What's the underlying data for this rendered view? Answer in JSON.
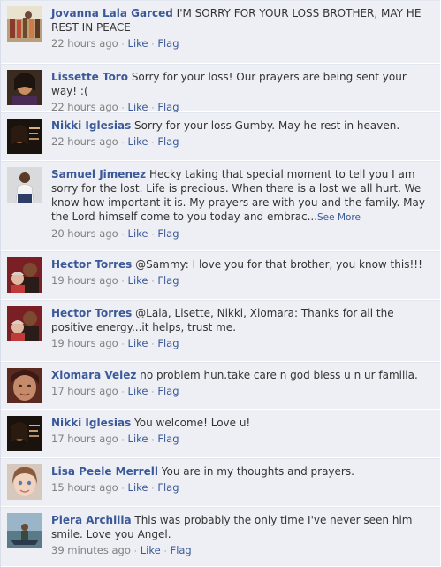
{
  "comments": [
    {
      "author": "Jovanna Lala Garced",
      "text": "I'M SORRY FOR YOUR LOSS BROTHER, MAY HE REST IN PEACE",
      "time": "22 hours ago",
      "like": "Like",
      "flag": "Flag",
      "avatar": "avatar-jovanna",
      "see_more": ""
    },
    {
      "author": "Lissette Toro",
      "text": "Sorry for your loss! Our prayers are being sent your way! :(",
      "time": "22 hours ago",
      "like": "Like",
      "flag": "Flag",
      "avatar": "avatar-lissette",
      "see_more": ""
    },
    {
      "author": "Nikki Iglesias",
      "text": "Sorry for your loss Gumby. May he rest in heaven.",
      "time": "22 hours ago",
      "like": "Like",
      "flag": "Flag",
      "avatar": "avatar-nikki",
      "see_more": ""
    },
    {
      "author": "Samuel Jimenez",
      "text": "Hecky taking that special moment to tell you I am sorry for the lost. Life is precious. When there is a lost we all hurt. We know how important it is. My prayers are with you and the family. May the Lord himself come to you today and embrac...",
      "time": "20 hours ago",
      "like": "Like",
      "flag": "Flag",
      "avatar": "avatar-samuel",
      "see_more": "See More"
    },
    {
      "author": "Hector Torres",
      "text": "@Sammy: I love you for that brother, you know this!!!",
      "time": "19 hours ago",
      "like": "Like",
      "flag": "Flag",
      "avatar": "avatar-hector",
      "see_more": ""
    },
    {
      "author": "Hector Torres",
      "text": "@Lala, Lisette, Nikki, Xiomara: Thanks for all the positive energy...it helps, trust me.",
      "time": "19 hours ago",
      "like": "Like",
      "flag": "Flag",
      "avatar": "avatar-hector",
      "see_more": ""
    },
    {
      "author": "Xiomara Velez",
      "text": "no problem hun.take care n god bless u n ur familia.",
      "time": "17 hours ago",
      "like": "Like",
      "flag": "Flag",
      "avatar": "avatar-xiomara",
      "see_more": ""
    },
    {
      "author": "Nikki Iglesias",
      "text": "You welcome! Love u!",
      "time": "17 hours ago",
      "like": "Like",
      "flag": "Flag",
      "avatar": "avatar-nikki",
      "see_more": ""
    },
    {
      "author": "Lisa Peele Merrell",
      "text": "You are in my thoughts and prayers.",
      "time": "15 hours ago",
      "like": "Like",
      "flag": "Flag",
      "avatar": "avatar-lisa",
      "see_more": ""
    },
    {
      "author": "Piera Archilla",
      "text": "This was probably the only time I've never seen him smile. Love you Angel.",
      "time": "39 minutes ago",
      "like": "Like",
      "flag": "Flag",
      "avatar": "avatar-piera",
      "see_more": ""
    }
  ]
}
